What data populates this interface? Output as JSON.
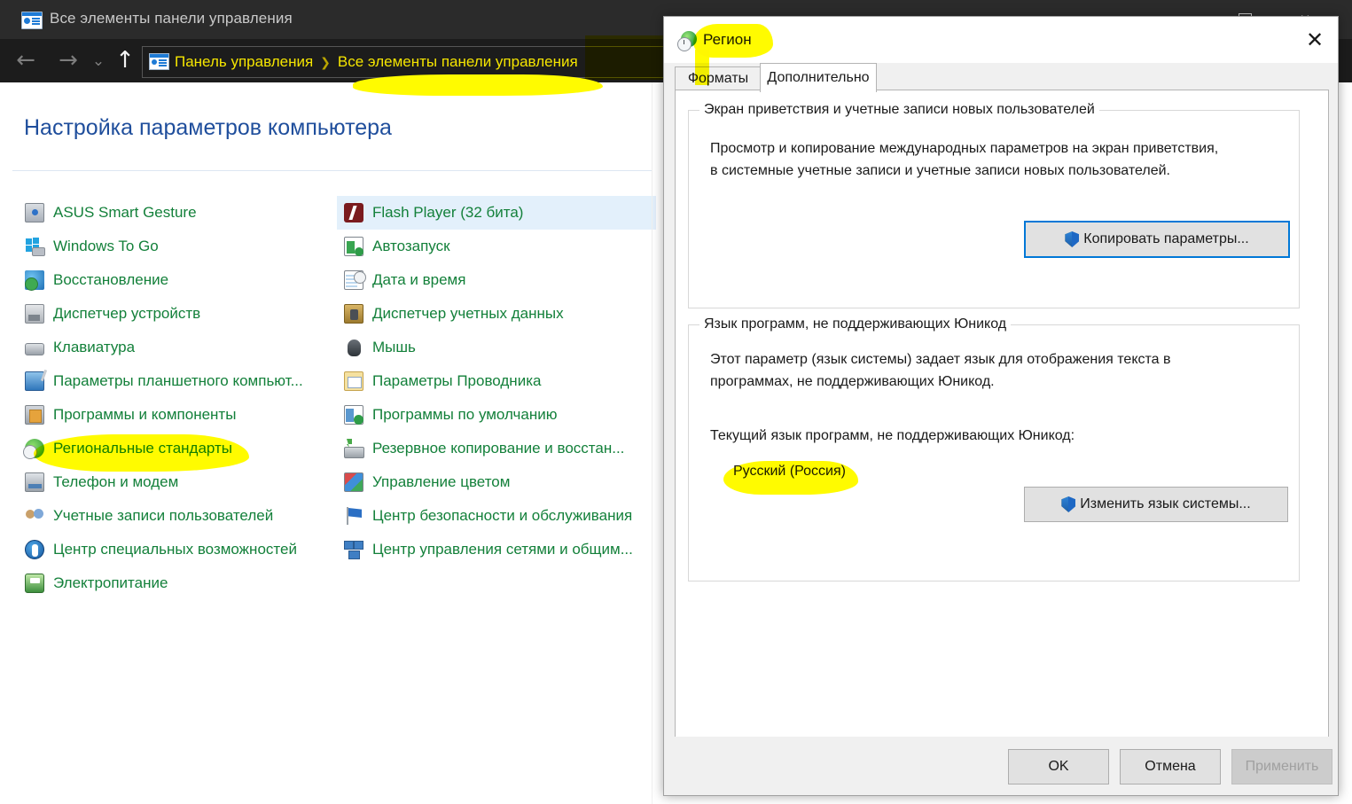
{
  "control_panel": {
    "window_title": "Все элементы панели управления",
    "title_icon": "control-panel-icon",
    "window_buttons": {
      "minimize": "minimize-icon",
      "maximize": "maximize-icon",
      "close": "✕"
    },
    "nav": {
      "back": "←",
      "forward": "→",
      "recent": "⌄",
      "up": "↑"
    },
    "breadcrumb": {
      "icon": "control-panel-icon",
      "separator": "❯",
      "items": [
        "Панель управления",
        "Все элементы панели управления"
      ]
    },
    "heading": "Настройка параметров компьютера",
    "items_left": [
      {
        "label": "ASUS Smart Gesture",
        "icon": "gi-monitor"
      },
      {
        "label": "Windows To Go",
        "icon": "gi-win"
      },
      {
        "label": "Восстановление",
        "icon": "gi-restore"
      },
      {
        "label": "Диспетчер устройств",
        "icon": "gi-device"
      },
      {
        "label": "Клавиатура",
        "icon": "gi-keyboard"
      },
      {
        "label": "Параметры планшетного компьют...",
        "icon": "gi-tablet"
      },
      {
        "label": "Программы и компоненты",
        "icon": "gi-programs"
      },
      {
        "label": "Региональные стандарты",
        "icon": "gi-region"
      },
      {
        "label": "Телефон и модем",
        "icon": "gi-phone"
      },
      {
        "label": "Учетные записи пользователей",
        "icon": "gi-users"
      },
      {
        "label": "Центр специальных возможностей",
        "icon": "gi-ease"
      },
      {
        "label": "Электропитание",
        "icon": "gi-power"
      }
    ],
    "items_right": [
      {
        "label": "Flash Player (32 бита)",
        "icon": "gi-flash",
        "selected": true
      },
      {
        "label": "Автозапуск",
        "icon": "gi-autorun"
      },
      {
        "label": "Дата и время",
        "icon": "gi-datetime"
      },
      {
        "label": "Диспетчер учетных данных",
        "icon": "gi-cred"
      },
      {
        "label": "Мышь",
        "icon": "gi-mouse"
      },
      {
        "label": "Параметры Проводника",
        "icon": "gi-explorer"
      },
      {
        "label": "Программы по умолчанию",
        "icon": "gi-default"
      },
      {
        "label": "Резервное копирование и восстан...",
        "icon": "gi-backup"
      },
      {
        "label": "Управление цветом",
        "icon": "gi-color"
      },
      {
        "label": "Центр безопасности и обслуживания",
        "icon": "gi-security"
      },
      {
        "label": "Центр управления сетями и общим...",
        "icon": "gi-network"
      }
    ]
  },
  "region_dialog": {
    "title": "Регион",
    "title_icon": "region-globe-clock-icon",
    "close_label": "✕",
    "tabs": [
      {
        "label": "Форматы",
        "active": false
      },
      {
        "label": "Дополнительно",
        "active": true
      }
    ],
    "group_welcome": {
      "title": "Экран приветствия и учетные записи новых пользователей",
      "description": "Просмотр и копирование международных параметров на экран приветствия, в системные учетные записи и учетные записи новых пользователей.",
      "button_label": "Копировать параметры...",
      "button_icon": "uac-shield-icon"
    },
    "group_language": {
      "title": "Язык программ, не поддерживающих Юникод",
      "description": "Этот параметр (язык системы) задает язык для отображения текста в программах, не поддерживающих Юникод.",
      "current_label": "Текущий язык программ, не поддерживающих Юникод:",
      "current_value": "Русский (Россия)",
      "button_label": "Изменить язык системы...",
      "button_icon": "uac-shield-icon"
    },
    "footer": {
      "ok": "OK",
      "cancel": "Отмена",
      "apply": "Применить",
      "apply_disabled": true
    }
  },
  "annotations": {
    "highlighter_color": "#FFFB00",
    "marks": [
      "breadcrumb-highlight",
      "regional-standards-highlight",
      "region-title-highlight",
      "current-language-highlight"
    ]
  },
  "theme": {
    "link_green": "#13803A",
    "heading_blue": "#1F4E9C",
    "breadcrumb_yellow": "#F5E500",
    "titlebar_dark": "#2B2B2B",
    "navbar_dark": "#1C1C1C",
    "selection_blue": "#E3F0FB",
    "focus_blue": "#0078D7",
    "dialog_gray": "#F0F0F0"
  }
}
